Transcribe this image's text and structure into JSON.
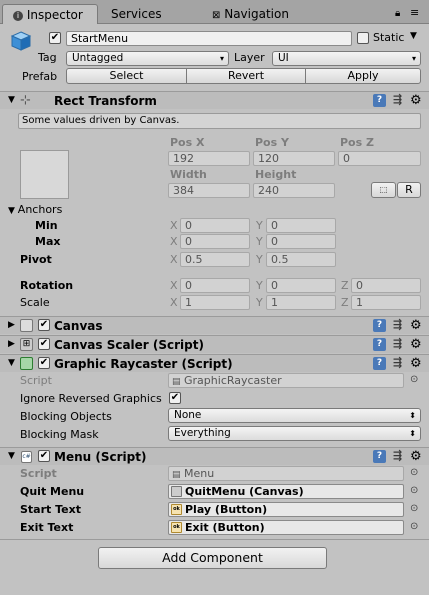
{
  "tabs": {
    "inspector": "Inspector",
    "services": "Services",
    "navigation": "Navigation"
  },
  "object": {
    "name": "StartMenu",
    "static_label": "Static",
    "tag_label": "Tag",
    "tag_value": "Untagged",
    "layer_label": "Layer",
    "layer_value": "UI",
    "prefab_label": "Prefab",
    "select": "Select",
    "revert": "Revert",
    "apply": "Apply"
  },
  "rect": {
    "title": "Rect Transform",
    "note": "Some values driven by Canvas.",
    "posx_label": "Pos X",
    "posy_label": "Pos Y",
    "posz_label": "Pos Z",
    "posx": "192",
    "posy": "120",
    "posz": "0",
    "width_label": "Width",
    "height_label": "Height",
    "width": "384",
    "height": "240",
    "r_label": "R",
    "anchors": "Anchors",
    "min": "Min",
    "max": "Max",
    "pivot": "Pivot",
    "rotation": "Rotation",
    "scale": "Scale",
    "x": "X",
    "y": "Y",
    "z": "Z",
    "min_x": "0",
    "min_y": "0",
    "max_x": "0",
    "max_y": "0",
    "pivot_x": "0.5",
    "pivot_y": "0.5",
    "rot_x": "0",
    "rot_y": "0",
    "rot_z": "0",
    "scale_x": "1",
    "scale_y": "1",
    "scale_z": "1"
  },
  "canvas": {
    "title": "Canvas"
  },
  "scaler": {
    "title": "Canvas Scaler (Script)"
  },
  "raycaster": {
    "title": "Graphic Raycaster (Script)",
    "script_label": "Script",
    "script_value": "GraphicRaycaster",
    "ignore_label": "Ignore Reversed Graphics",
    "blocking_objects_label": "Blocking Objects",
    "blocking_objects_value": "None",
    "blocking_mask_label": "Blocking Mask",
    "blocking_mask_value": "Everything"
  },
  "menu": {
    "title": "Menu (Script)",
    "script_label": "Script",
    "script_value": "Menu",
    "quit_label": "Quit Menu",
    "quit_value": "QuitMenu (Canvas)",
    "start_label": "Start Text",
    "start_value": "Play (Button)",
    "exit_label": "Exit Text",
    "exit_value": "Exit (Button)"
  },
  "add_component": "Add Component",
  "icons": [
    "info-icon",
    "grid-icon",
    "lock-icon",
    "menu-icon",
    "cube-icon",
    "rect-transform-icon",
    "help-icon",
    "preset-icon",
    "gear-icon",
    "script-icon",
    "object-picker-icon"
  ]
}
